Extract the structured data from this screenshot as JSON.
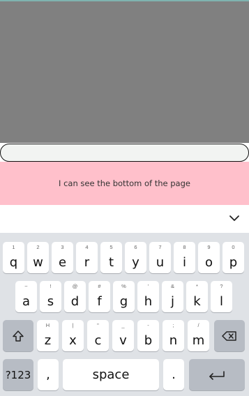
{
  "page": {
    "message": "I can see the bottom of the page"
  },
  "input": {
    "value": ""
  },
  "keyboard": {
    "row1": [
      {
        "hint": "1",
        "char": "q"
      },
      {
        "hint": "2",
        "char": "w"
      },
      {
        "hint": "3",
        "char": "e"
      },
      {
        "hint": "4",
        "char": "r"
      },
      {
        "hint": "5",
        "char": "t"
      },
      {
        "hint": "6",
        "char": "y"
      },
      {
        "hint": "7",
        "char": "u"
      },
      {
        "hint": "8",
        "char": "i"
      },
      {
        "hint": "9",
        "char": "o"
      },
      {
        "hint": "0",
        "char": "p"
      }
    ],
    "row2": [
      {
        "hint": "~",
        "char": "a"
      },
      {
        "hint": "!",
        "char": "s"
      },
      {
        "hint": "@",
        "char": "d"
      },
      {
        "hint": "#",
        "char": "f"
      },
      {
        "hint": "%",
        "char": "g"
      },
      {
        "hint": "'",
        "char": "h"
      },
      {
        "hint": "&",
        "char": "j"
      },
      {
        "hint": "*",
        "char": "k"
      },
      {
        "hint": "?",
        "char": "l"
      }
    ],
    "row3": [
      {
        "hint": "H",
        "char": "z"
      },
      {
        "hint": "|",
        "char": "x"
      },
      {
        "hint": "\"",
        "char": "c"
      },
      {
        "hint": "_",
        "char": "v"
      },
      {
        "hint": "-",
        "char": "b"
      },
      {
        "hint": ";",
        "char": "n"
      },
      {
        "hint": "/",
        "char": "m"
      }
    ],
    "symbols_label": "?123",
    "comma_label": ",",
    "space_label": "space",
    "period_label": "."
  },
  "icons": {
    "shift": "shift-arrow-icon",
    "backspace": "backspace-icon",
    "enter": "enter-return-icon",
    "collapse": "chevron-down-icon"
  },
  "colors": {
    "gray_area": "#808080",
    "pink_area": "#ffc0cb",
    "keyboard_bg": "#dfe2e6",
    "key_bg": "#ffffff",
    "fn_key_bg": "#b7bcc4"
  }
}
